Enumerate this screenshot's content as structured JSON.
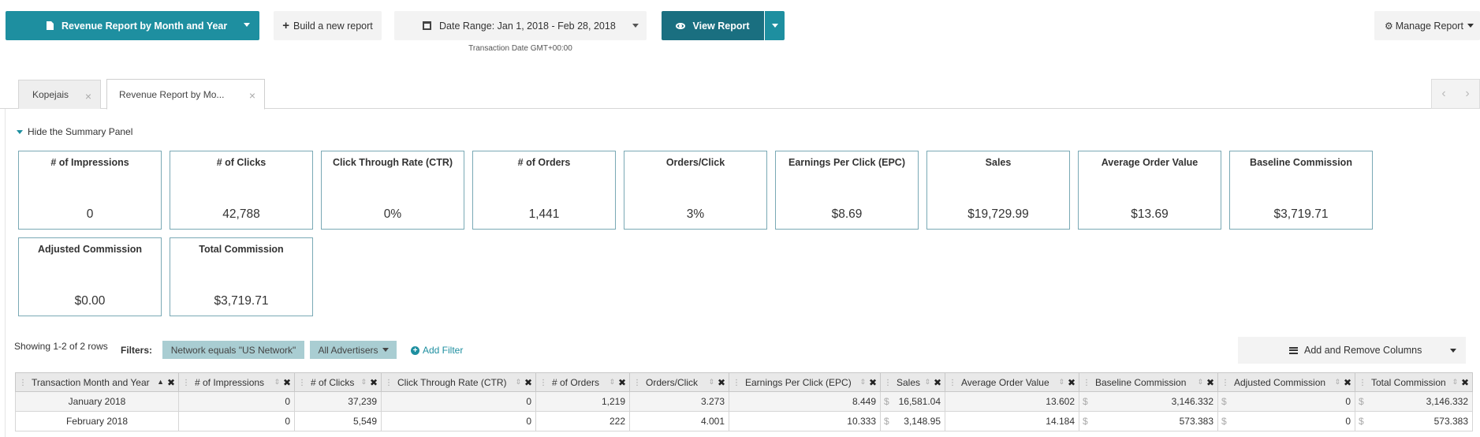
{
  "toolbar": {
    "report_button_label": "Revenue Report by Month and Year",
    "build_button_label": "Build a new report",
    "date_range_label": "Date Range: Jan 1, 2018 - Feb 28, 2018",
    "transaction_date_note": "Transaction Date GMT+00:00",
    "view_report_label": "View Report",
    "manage_report_label": "Manage Report"
  },
  "tabs": [
    {
      "label": "Kopejais"
    },
    {
      "label": "Revenue Report by Mo..."
    }
  ],
  "summary": {
    "toggle_label": "Hide the Summary Panel",
    "cards": [
      {
        "title": "# of Impressions",
        "value": "0"
      },
      {
        "title": "# of Clicks",
        "value": "42,788"
      },
      {
        "title": "Click Through Rate (CTR)",
        "value": "0%"
      },
      {
        "title": "# of Orders",
        "value": "1,441"
      },
      {
        "title": "Orders/Click",
        "value": "3%"
      },
      {
        "title": "Earnings Per Click (EPC)",
        "value": "$8.69"
      },
      {
        "title": "Sales",
        "value": "$19,729.99"
      },
      {
        "title": "Average Order Value",
        "value": "$13.69"
      },
      {
        "title": "Baseline Commission",
        "value": "$3,719.71"
      },
      {
        "title": "Adjusted Commission",
        "value": "$0.00"
      },
      {
        "title": "Total Commission",
        "value": "$3,719.71"
      }
    ]
  },
  "filters": {
    "showing_text": "Showing 1-2 of 2 rows",
    "label": "Filters:",
    "chips": [
      "Network equals \"US Network\"",
      "All Advertisers"
    ],
    "add_filter_label": "Add Filter",
    "columns_button_label": "Add and Remove Columns"
  },
  "table": {
    "columns": [
      "Transaction Month and Year",
      "# of Impressions",
      "# of Clicks",
      "Click Through Rate (CTR)",
      "# of Orders",
      "Orders/Click",
      "Earnings Per Click (EPC)",
      "Sales",
      "Average Order Value",
      "Baseline Commission",
      "Adjusted Commission",
      "Total Commission"
    ],
    "currency_symbol": "$",
    "rows": [
      [
        "January 2018",
        "0",
        "37,239",
        "0",
        "1,219",
        "3.273",
        "8.449",
        "16,581.04",
        "13.602",
        "3,146.332",
        "0",
        "3,146.332"
      ],
      [
        "February 2018",
        "0",
        "5,549",
        "0",
        "222",
        "4.001",
        "10.333",
        "3,148.95",
        "14.184",
        "573.383",
        "0",
        "573.383"
      ]
    ]
  },
  "colors": {
    "accent": "#1e8fa0",
    "accent_dark": "#1a6f80",
    "card_border": "#7aa9b5",
    "filter_chip": "#a9cdd2"
  },
  "icons": {
    "report": "document-icon",
    "build": "plus-icon",
    "date": "calendar-icon",
    "view": "eye-icon",
    "manage": "gear-icon",
    "columns": "list-icon",
    "add_filter": "plus-circle-icon"
  }
}
